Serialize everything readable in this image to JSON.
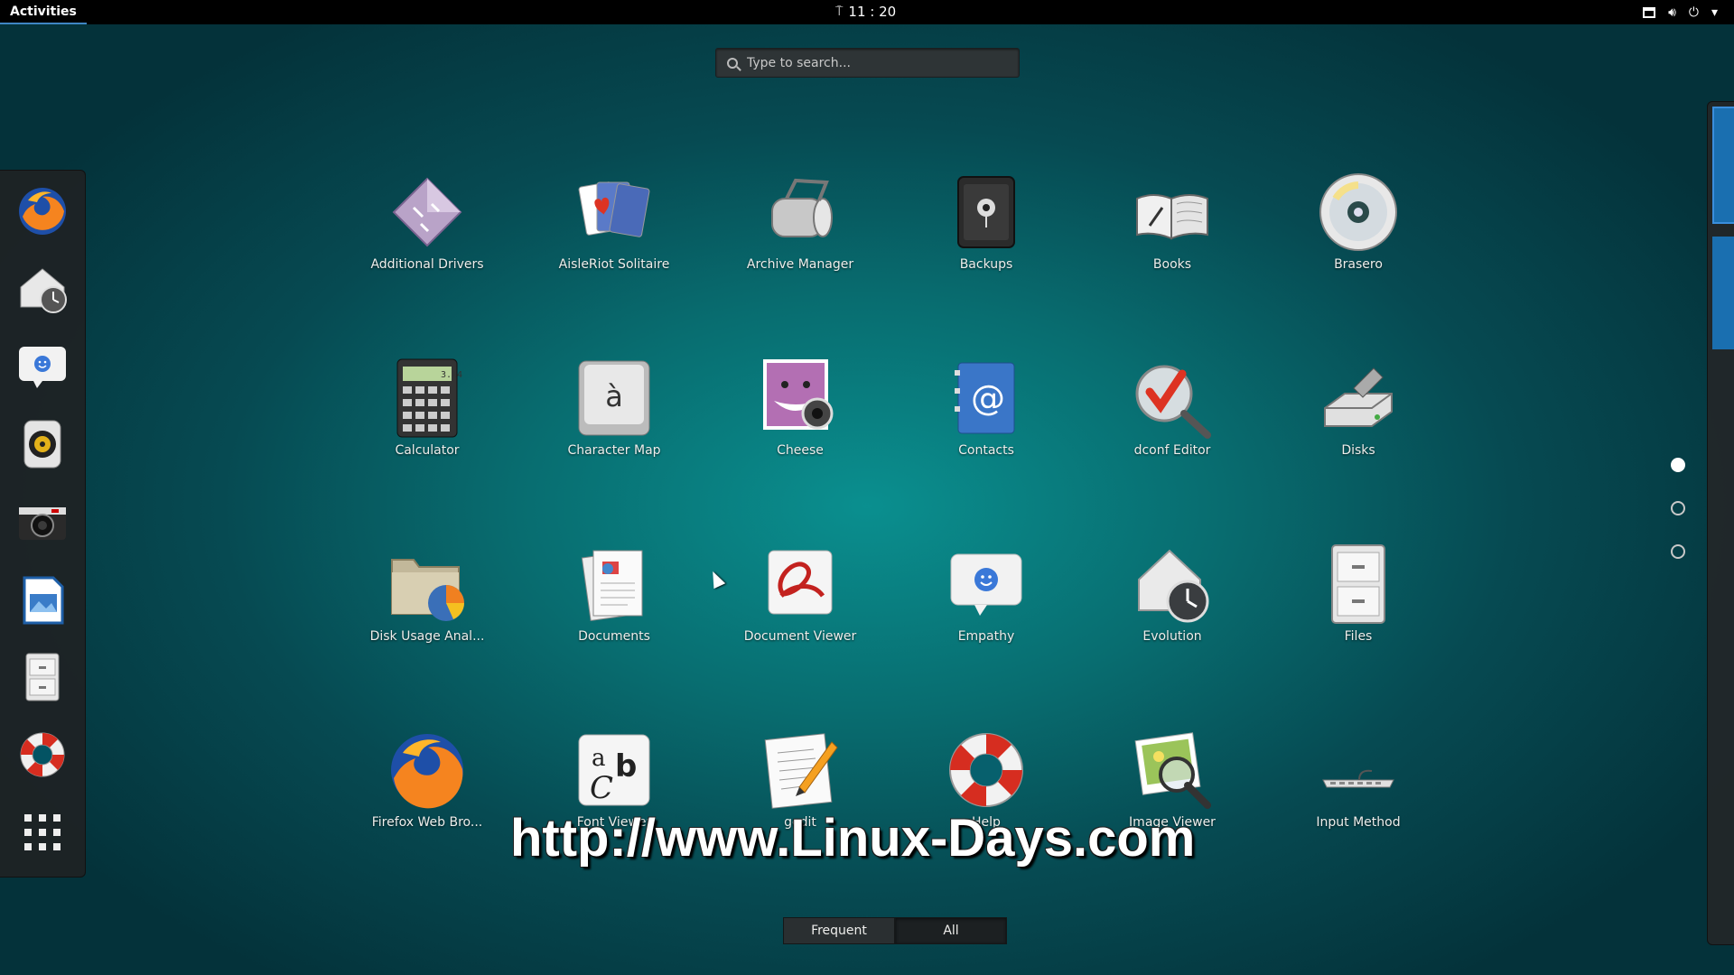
{
  "topbar": {
    "activities_label": "Activities",
    "clock": "11 : 20",
    "tray_icons": [
      "window-icon",
      "volume-icon",
      "power-icon",
      "dropdown-icon"
    ]
  },
  "search": {
    "placeholder": "Type to search..."
  },
  "dash": {
    "items": [
      "firefox-icon",
      "evolution-icon",
      "empathy-icon",
      "rhythmbox-icon",
      "cheese-camera-icon",
      "writer-document-icon",
      "files-icon",
      "help-icon",
      "show-apps-icon"
    ]
  },
  "apps": [
    {
      "label": "Additional Drivers",
      "icon": "additional-drivers-icon"
    },
    {
      "label": "AisleRiot Solitaire",
      "icon": "aisleriot-icon"
    },
    {
      "label": "Archive Manager",
      "icon": "archive-manager-icon"
    },
    {
      "label": "Backups",
      "icon": "backups-icon"
    },
    {
      "label": "Books",
      "icon": "books-icon"
    },
    {
      "label": "Brasero",
      "icon": "brasero-icon"
    },
    {
      "label": "Calculator",
      "icon": "calculator-icon"
    },
    {
      "label": "Character Map",
      "icon": "character-map-icon"
    },
    {
      "label": "Cheese",
      "icon": "cheese-icon"
    },
    {
      "label": "Contacts",
      "icon": "contacts-icon"
    },
    {
      "label": "dconf Editor",
      "icon": "dconf-editor-icon"
    },
    {
      "label": "Disks",
      "icon": "disks-icon"
    },
    {
      "label": "Disk Usage Anal...",
      "icon": "disk-usage-icon"
    },
    {
      "label": "Documents",
      "icon": "documents-icon"
    },
    {
      "label": "Document Viewer",
      "icon": "document-viewer-icon"
    },
    {
      "label": "Empathy",
      "icon": "empathy-icon"
    },
    {
      "label": "Evolution",
      "icon": "evolution-icon"
    },
    {
      "label": "Files",
      "icon": "files-icon"
    },
    {
      "label": "Firefox Web Bro...",
      "icon": "firefox-icon"
    },
    {
      "label": "Font Viewer",
      "icon": "font-viewer-icon"
    },
    {
      "label": "gedit",
      "icon": "gedit-icon"
    },
    {
      "label": "Help",
      "icon": "help-icon"
    },
    {
      "label": "Image Viewer",
      "icon": "image-viewer-icon"
    },
    {
      "label": "Input Method",
      "icon": "input-method-icon"
    }
  ],
  "pages": {
    "count": 3,
    "current": 1
  },
  "view_toggle": {
    "frequent": "Frequent",
    "all": "All",
    "active": "all"
  },
  "watermark": "http://www.Linux-Days.com"
}
